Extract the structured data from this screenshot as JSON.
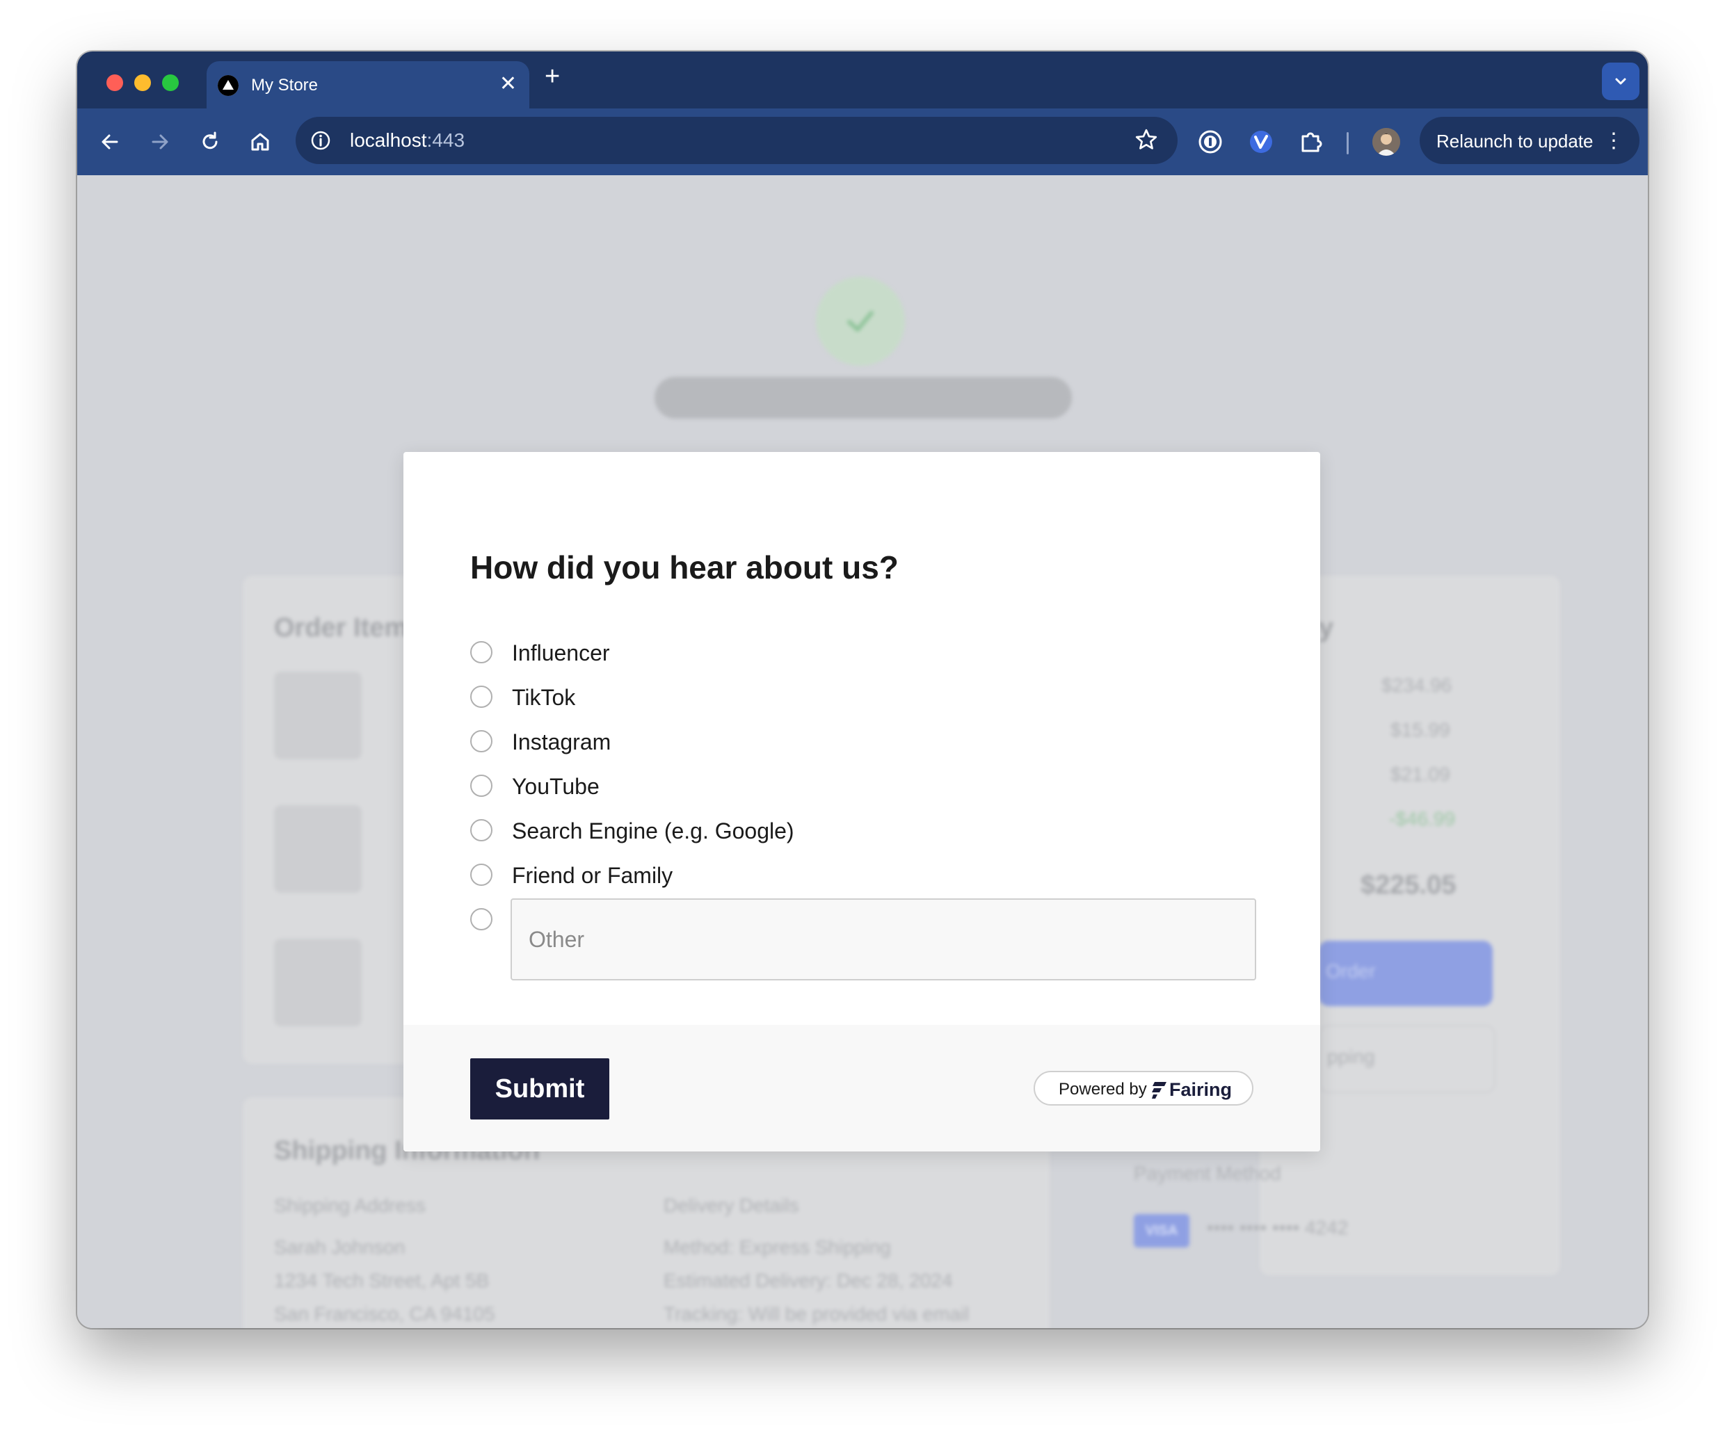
{
  "browser": {
    "tab": {
      "title": "My Store"
    },
    "address_bar": {
      "host": "localhost",
      "port": ":443"
    },
    "relaunch_label": "Relaunch to update",
    "traffic_lights": {
      "close": "#ff5f57",
      "minimize": "#febc2e",
      "zoom": "#28c840"
    },
    "icons": [
      "back-icon",
      "forward-icon",
      "reload-icon",
      "home-icon",
      "site-info-icon",
      "bookmark-star-icon",
      "password-manager-icon",
      "extension-v-icon",
      "puzzle-extensions-icon",
      "profile-avatar",
      "menu-kebab-icon",
      "tab-search-icon"
    ]
  },
  "background_page": {
    "order_items_heading": "Order Item",
    "shipping": {
      "heading": "Shipping Information",
      "address_label": "Shipping Address",
      "address_lines": [
        "Sarah Johnson",
        "1234 Tech Street, Apt 5B",
        "San Francisco, CA 94105"
      ],
      "delivery_label": "Delivery Details",
      "delivery_lines": [
        "Method: Express Shipping",
        "Estimated Delivery: Dec 28, 2024",
        "Tracking: Will be provided via email"
      ]
    },
    "summary": {
      "heading_fragment": "y",
      "amounts": [
        "$234.96",
        "$15.99",
        "$21.09",
        "-$46.99"
      ],
      "total": "$225.05",
      "primary_button_fragment": "Order",
      "secondary_button_fragment": "pping"
    },
    "payment": {
      "label": "Payment Method",
      "card_brand": "VISA",
      "card_number": "•••• •••• •••• 4242"
    }
  },
  "survey": {
    "question": "How did you hear about us?",
    "options": [
      {
        "label": "Influencer"
      },
      {
        "label": "TikTok"
      },
      {
        "label": "Instagram"
      },
      {
        "label": "YouTube"
      },
      {
        "label": "Search Engine (e.g. Google)"
      },
      {
        "label": "Friend or Family"
      }
    ],
    "other_placeholder": "Other",
    "submit_label": "Submit",
    "powered_by": "Powered by",
    "brand": "Fairing"
  },
  "colors": {
    "chrome_dark": "#1d3461",
    "chrome_mid": "#2a4a86",
    "submit_bg": "#1a1d3b",
    "overlay_bg": "#d2d4d9"
  }
}
